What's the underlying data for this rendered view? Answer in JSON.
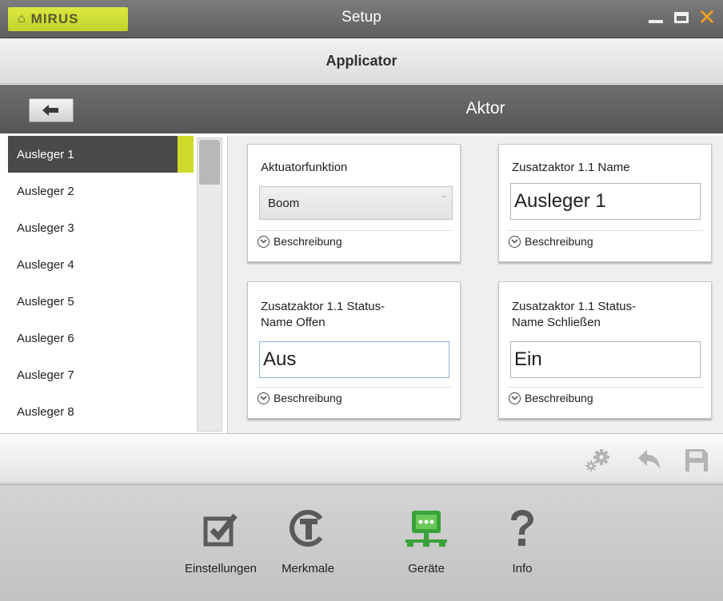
{
  "window": {
    "brand": "MIRUS",
    "title": "Setup",
    "colors": {
      "accent": "#cfdb2a",
      "close": "#f0a020",
      "nav_active": "#3aa23a"
    }
  },
  "header": {
    "title": "Applicator"
  },
  "section": {
    "title": "Aktor"
  },
  "sidebar": {
    "items": [
      {
        "label": "Ausleger 1",
        "selected": true
      },
      {
        "label": "Ausleger 2"
      },
      {
        "label": "Ausleger 3"
      },
      {
        "label": "Ausleger 4"
      },
      {
        "label": "Ausleger 5"
      },
      {
        "label": "Ausleger 6"
      },
      {
        "label": "Ausleger 7"
      },
      {
        "label": "Ausleger 8"
      }
    ]
  },
  "cards": {
    "function": {
      "label": "Aktuatorfunktion",
      "value": "Boom",
      "desc": "Beschreibung"
    },
    "name": {
      "label": "Zusatzaktor 1.1 Name",
      "value": "Ausleger 1",
      "desc": "Beschreibung"
    },
    "open_name": {
      "label_line1": "Zusatzaktor 1.1 Status-",
      "label_line2": "Name Offen",
      "value": "Aus",
      "desc": "Beschreibung"
    },
    "close_name": {
      "label_line1": "Zusatzaktor 1.1 Status-",
      "label_line2": "Name Schließen",
      "value": "Ein",
      "desc": "Beschreibung"
    }
  },
  "toolbar": {
    "icons": [
      "gears-icon",
      "undo-icon",
      "save-icon"
    ]
  },
  "nav": {
    "items": [
      {
        "label": "Einstellungen",
        "icon": "checkbox-icon"
      },
      {
        "label": "Merkmale",
        "icon": "tc-icon"
      },
      {
        "label": "Geräte",
        "icon": "devices-icon",
        "active": true
      },
      {
        "label": "Info",
        "icon": "question-icon"
      }
    ]
  }
}
